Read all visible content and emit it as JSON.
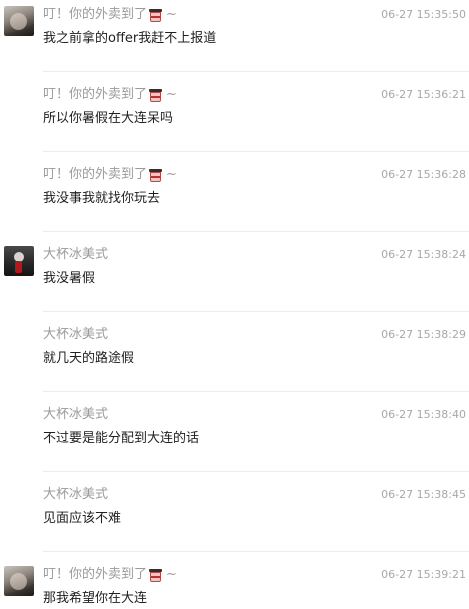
{
  "messages": [
    {
      "sender": "叮！你的外卖到了",
      "sender_suffix": "~",
      "has_cup_emoji": true,
      "show_avatar": true,
      "avatar": "avatar-a",
      "time": "06-27 15:35:50",
      "text": "我之前拿的offer我赶不上报道"
    },
    {
      "sender": "叮！你的外卖到了",
      "sender_suffix": "~",
      "has_cup_emoji": true,
      "show_avatar": false,
      "avatar": "avatar-a",
      "time": "06-27 15:36:21",
      "text": "所以你暑假在大连呆吗"
    },
    {
      "sender": "叮！你的外卖到了",
      "sender_suffix": "~",
      "has_cup_emoji": true,
      "show_avatar": false,
      "avatar": "avatar-a",
      "time": "06-27 15:36:28",
      "text": "我没事我就找你玩去"
    },
    {
      "sender": "大杯冰美式",
      "sender_suffix": "",
      "has_cup_emoji": false,
      "show_avatar": true,
      "avatar": "avatar-b",
      "time": "06-27 15:38:24",
      "text": "我没暑假"
    },
    {
      "sender": "大杯冰美式",
      "sender_suffix": "",
      "has_cup_emoji": false,
      "show_avatar": false,
      "avatar": "avatar-b",
      "time": "06-27 15:38:29",
      "text": "就几天的路途假"
    },
    {
      "sender": "大杯冰美式",
      "sender_suffix": "",
      "has_cup_emoji": false,
      "show_avatar": false,
      "avatar": "avatar-b",
      "time": "06-27 15:38:40",
      "text": "不过要是能分配到大连的话"
    },
    {
      "sender": "大杯冰美式",
      "sender_suffix": "",
      "has_cup_emoji": false,
      "show_avatar": false,
      "avatar": "avatar-b",
      "time": "06-27 15:38:45",
      "text": "见面应该不难"
    },
    {
      "sender": "叮！你的外卖到了",
      "sender_suffix": "~",
      "has_cup_emoji": true,
      "show_avatar": true,
      "avatar": "avatar-a",
      "time": "06-27 15:39:21",
      "text": "那我希望你在大连"
    }
  ]
}
